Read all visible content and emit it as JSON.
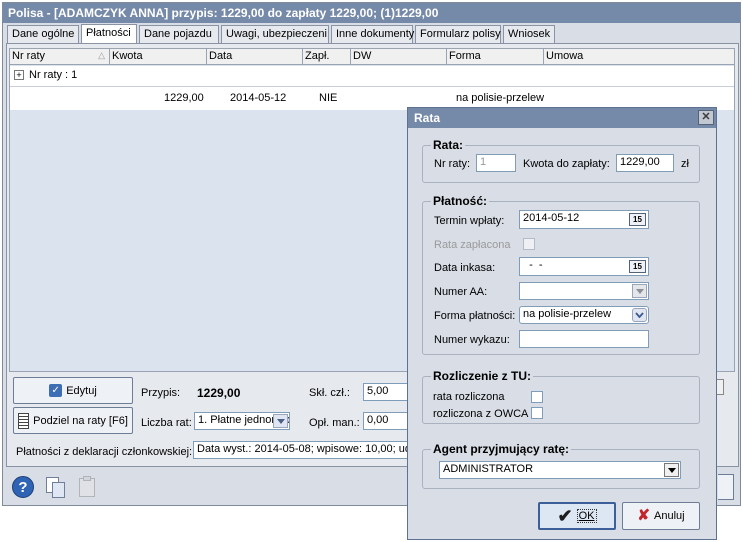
{
  "window": {
    "title": "Polisa - [ADAMCZYK ANNA]  przypis: 1229,00 do zapłaty 1229,00; (1)1229,00"
  },
  "tabs": [
    {
      "label": "Dane ogólne"
    },
    {
      "label": "Płatności"
    },
    {
      "label": "Dane pojazdu"
    },
    {
      "label": "Uwagi, ubezpieczeni"
    },
    {
      "label": "Inne dokumenty"
    },
    {
      "label": "Formularz polisy"
    },
    {
      "label": "Wniosek"
    }
  ],
  "grid": {
    "columns": [
      "Nr raty",
      "Kwota",
      "Data",
      "Zapł.",
      "DW",
      "Forma",
      "Umowa"
    ],
    "group_label": "Nr raty : 1",
    "rows": [
      {
        "kwota": "1229,00",
        "data": "2014-05-12",
        "zapl": "NIE",
        "dw": "",
        "forma": "na polisie-przelew",
        "umowa": ""
      }
    ]
  },
  "bottom": {
    "edit_button": "Edytuj",
    "split_button": "Podziel na raty [F6]",
    "przypis_label": "Przypis:",
    "przypis_value": "1229,00",
    "skl_label": "Skł. czł.:",
    "skl_value": "5,00",
    "liczba_label": "Liczba rat:",
    "liczba_value": "1. Płatne jednorazo",
    "opl_label": "Opł. man.:",
    "opl_value": "0,00",
    "deklaracje_label": "Płatności z deklaracji członkowskiej:",
    "deklaracje_value": "Data wyst.: 2014-05-08; wpisowe: 10,00; udz"
  },
  "dialog": {
    "title": "Rata",
    "close_glyph": "✕",
    "rata_group": "Rata:",
    "nr_raty_label": "Nr raty:",
    "nr_raty_value": "1",
    "kwota_label": "Kwota do zapłaty:",
    "kwota_value": "1229,00",
    "kwota_unit": "zł",
    "platnosc_group": "Płatność:",
    "termin_label": "Termin wpłaty:",
    "termin_value": "2014-05-12",
    "calendar_glyph": "15",
    "zaplacona_label": "Rata zapłacona",
    "data_inkasa_label": "Data inkasa:",
    "data_inkasa_value": "  -  -",
    "numer_aa_label": "Numer AA:",
    "numer_aa_value": "",
    "forma_label": "Forma płatności:",
    "forma_value": "na polisie-przelew",
    "wykaz_label": "Numer wykazu:",
    "wykaz_value": "",
    "tu_group": "Rozliczenie z TU:",
    "rata_rozliczona_label": "rata rozliczona",
    "owca_label": "rozliczona z OWCA",
    "agent_group": "Agent przyjmujący ratę:",
    "agent_value": "ADMINISTRATOR",
    "ok_label": "OK",
    "cancel_label": "Anuluj"
  }
}
